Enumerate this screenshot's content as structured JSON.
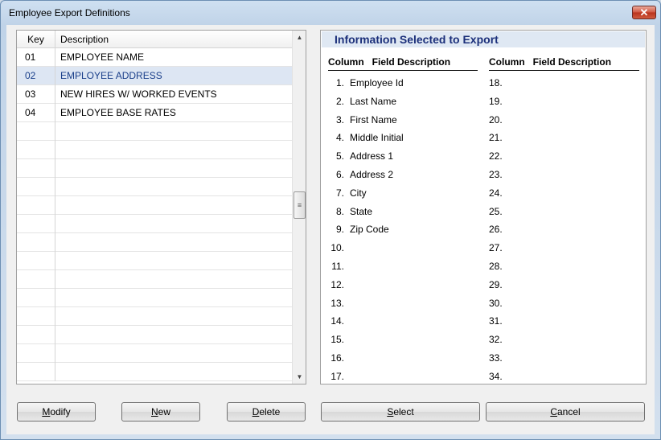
{
  "window": {
    "title": "Employee Export Definitions",
    "close_label": "✕"
  },
  "grid": {
    "headers": {
      "key": "Key",
      "description": "Description"
    },
    "rows": [
      {
        "key": "01",
        "description": "EMPLOYEE NAME"
      },
      {
        "key": "02",
        "description": "EMPLOYEE ADDRESS",
        "selected": true
      },
      {
        "key": "03",
        "description": "NEW HIRES W/ WORKED EVENTS"
      },
      {
        "key": "04",
        "description": "EMPLOYEE BASE RATES"
      }
    ],
    "empty_rows": 14,
    "scroll": {
      "up": "▲",
      "down": "▼",
      "thumb_grip": "≡"
    }
  },
  "info": {
    "title": "Information Selected to Export",
    "column_header": {
      "column": "Column",
      "field": "Field Description"
    },
    "left_fields": [
      {
        "num": "1.",
        "name": "Employee Id"
      },
      {
        "num": "2.",
        "name": "Last Name"
      },
      {
        "num": "3.",
        "name": "First Name"
      },
      {
        "num": "4.",
        "name": "Middle Initial"
      },
      {
        "num": "5.",
        "name": "Address 1"
      },
      {
        "num": "6.",
        "name": "Address 2"
      },
      {
        "num": "7.",
        "name": "City"
      },
      {
        "num": "8.",
        "name": "State"
      },
      {
        "num": "9.",
        "name": "Zip Code"
      },
      {
        "num": "10.",
        "name": ""
      },
      {
        "num": "11.",
        "name": ""
      },
      {
        "num": "12.",
        "name": ""
      },
      {
        "num": "13.",
        "name": ""
      },
      {
        "num": "14.",
        "name": ""
      },
      {
        "num": "15.",
        "name": ""
      },
      {
        "num": "16.",
        "name": ""
      },
      {
        "num": "17.",
        "name": ""
      }
    ],
    "right_fields": [
      {
        "num": "18.",
        "name": ""
      },
      {
        "num": "19.",
        "name": ""
      },
      {
        "num": "20.",
        "name": ""
      },
      {
        "num": "21.",
        "name": ""
      },
      {
        "num": "22.",
        "name": ""
      },
      {
        "num": "23.",
        "name": ""
      },
      {
        "num": "24.",
        "name": ""
      },
      {
        "num": "25.",
        "name": ""
      },
      {
        "num": "26.",
        "name": ""
      },
      {
        "num": "27.",
        "name": ""
      },
      {
        "num": "28.",
        "name": ""
      },
      {
        "num": "29.",
        "name": ""
      },
      {
        "num": "30.",
        "name": ""
      },
      {
        "num": "31.",
        "name": ""
      },
      {
        "num": "32.",
        "name": ""
      },
      {
        "num": "33.",
        "name": ""
      },
      {
        "num": "34.",
        "name": ""
      }
    ]
  },
  "buttons": {
    "modify": {
      "mnemonic": "M",
      "rest": "odify"
    },
    "new": {
      "mnemonic": "N",
      "rest": "ew"
    },
    "delete": {
      "mnemonic": "D",
      "rest": "elete"
    },
    "select": {
      "mnemonic": "S",
      "rest": "elect"
    },
    "cancel": {
      "mnemonic": "C",
      "rest": "ancel"
    }
  },
  "colors": {
    "title_blue": "#1b2f7a",
    "selected_row": "#dde6f3"
  }
}
